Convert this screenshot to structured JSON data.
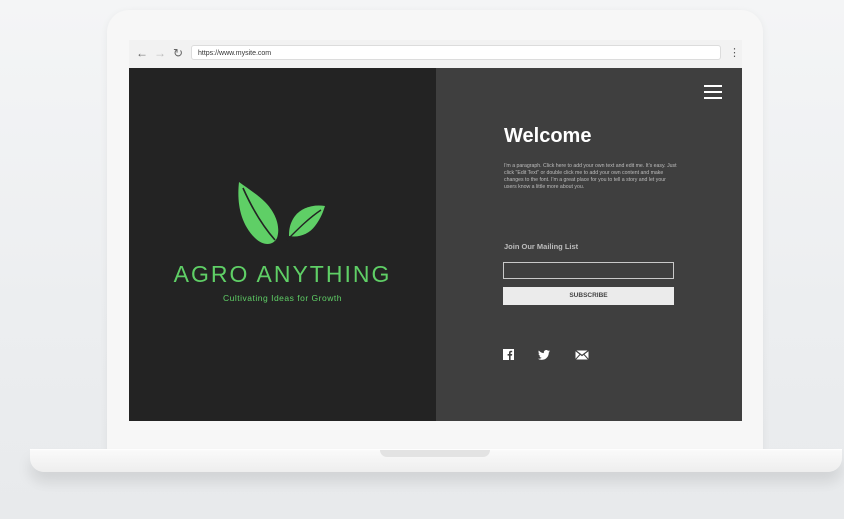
{
  "browser": {
    "url": "https://www.mysite.com",
    "back_icon": "arrow-left-icon",
    "forward_icon": "arrow-right-icon",
    "reload_icon": "reload-icon",
    "menu_icon": "vertical-dots-icon"
  },
  "site": {
    "brand_name": "AGRO ANYTHING",
    "tagline": "Cultivating Ideas for Growth",
    "welcome_title": "Welcome",
    "paragraph": "I'm a paragraph. Click here to add your own text and edit me. It's easy. Just click \"Edit Text\" or double click me to add your own content and make changes to the font. I'm a great place for you to tell a story and let your users know a little more about you.",
    "mailing_heading": "Join Our Mailing List",
    "email_value": "",
    "subscribe_label": "SUBSCRIBE",
    "social_icons": [
      "facebook-icon",
      "twitter-icon",
      "mail-icon"
    ]
  },
  "colors": {
    "brand_green": "#5fcf66",
    "left_bg": "#232323",
    "right_bg": "#3f3f3f"
  }
}
